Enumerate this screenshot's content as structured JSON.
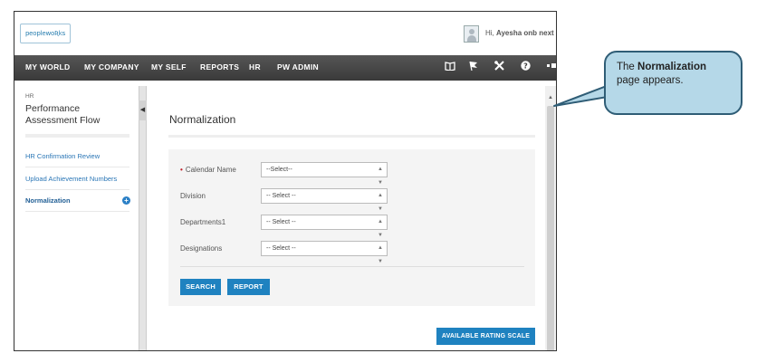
{
  "header": {
    "logo_text": "peoplewoƦks",
    "greeting_prefix": "Hi, ",
    "greeting_name": "Ayesha onb next"
  },
  "nav": {
    "items": [
      "MY WORLD",
      "MY COMPANY",
      "MY SELF",
      "REPORTS",
      "HR",
      "PW ADMIN"
    ],
    "icons": [
      "book-icon",
      "flag-icon",
      "tools-icon",
      "help-icon",
      "logout-icon"
    ]
  },
  "sidebar": {
    "section_label": "HR",
    "title": "Performance Assessment Flow",
    "items": [
      {
        "label": "HR Confirmation Review"
      },
      {
        "label": "Upload Achievement Numbers"
      },
      {
        "label": "Normalization"
      }
    ]
  },
  "main": {
    "page_title": "Normalization",
    "fields": [
      {
        "label": "Calendar Name",
        "value": "--Select--",
        "required": true
      },
      {
        "label": "Division",
        "value": "-- Select --"
      },
      {
        "label": "Departments1",
        "value": "-- Select --"
      },
      {
        "label": "Designations",
        "value": "-- Select --"
      }
    ],
    "search_label": "SEARCH",
    "report_label": "REPORT",
    "scale_label": "AVAILABLE RATING SCALE"
  },
  "callout": {
    "prefix": "The ",
    "bold": "Normalization",
    "suffix": " page appears."
  },
  "colors": {
    "nav_bg": "#3f3f3f",
    "button_blue": "#1f82c0",
    "link_blue": "#2a76b6",
    "callout_fill": "#b5d8e8",
    "callout_border": "#2f5d76"
  }
}
